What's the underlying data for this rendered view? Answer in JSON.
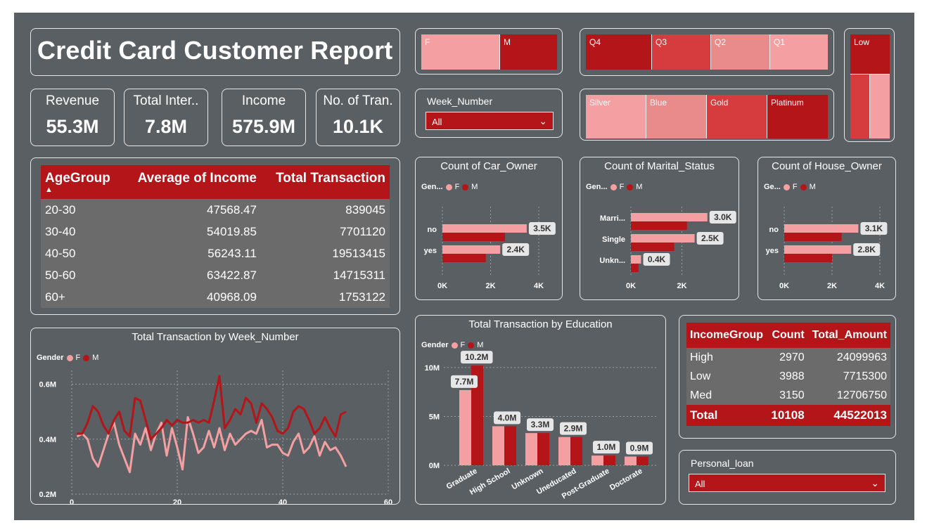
{
  "title": "Credit Card Customer Report",
  "kpis": [
    {
      "label": "Revenue",
      "value": "55.3M"
    },
    {
      "label": "Total Inter..",
      "value": "7.8M"
    },
    {
      "label": "Income",
      "value": "575.9M"
    },
    {
      "label": "No. of Tran.",
      "value": "10.1K"
    }
  ],
  "gender_slicer": [
    "F",
    "M"
  ],
  "quarter_slicer": [
    "Q4",
    "Q3",
    "Q2",
    "Q1"
  ],
  "card_slicer": [
    "Silver",
    "Blue",
    "Gold",
    "Platinum"
  ],
  "risk_slicer": [
    "Low"
  ],
  "week_filter": {
    "label": "Week_Number",
    "value": "All"
  },
  "loan_filter": {
    "label": "Personal_loan",
    "value": "All"
  },
  "age_table": {
    "headers": [
      "AgeGroup",
      "Average of Income",
      "Total Transaction"
    ],
    "rows": [
      [
        "20-30",
        "47568.47",
        "839045"
      ],
      [
        "30-40",
        "54019.85",
        "7701120"
      ],
      [
        "40-50",
        "56243.11",
        "19513415"
      ],
      [
        "50-60",
        "63422.87",
        "14715311"
      ],
      [
        "60+",
        "40968.09",
        "1753122"
      ]
    ]
  },
  "income_table": {
    "headers": [
      "IncomeGroup",
      "Count",
      "Total_Amount"
    ],
    "rows": [
      [
        "High",
        "2970",
        "24099963"
      ],
      [
        "Low",
        "3988",
        "7715300"
      ],
      [
        "Med",
        "3150",
        "12706750"
      ]
    ],
    "total": [
      "Total",
      "10108",
      "44522013"
    ]
  },
  "colors": {
    "female": "#f4a0a2",
    "male": "#b31519",
    "canvas": "#5a5f63"
  },
  "chart_data": [
    {
      "type": "bar",
      "title": "Count of Car_Owner",
      "legend_title": "Gen...",
      "categories": [
        "no",
        "yes"
      ],
      "series": [
        {
          "name": "F",
          "values": [
            3500,
            2400
          ]
        },
        {
          "name": "M",
          "values": [
            2600,
            1800
          ]
        }
      ],
      "data_labels": [
        "3.5K",
        "2.4K"
      ],
      "xticks": [
        "0K",
        "2K",
        "4K"
      ],
      "xlim": [
        0,
        4000
      ]
    },
    {
      "type": "bar",
      "title": "Count of Marital_Status",
      "legend_title": "Gen...",
      "categories": [
        "Marri...",
        "Single",
        "Unkn..."
      ],
      "series": [
        {
          "name": "F",
          "values": [
            3000,
            2500,
            400
          ]
        },
        {
          "name": "M",
          "values": [
            2200,
            1700,
            300
          ]
        }
      ],
      "data_labels": [
        "3.0K",
        "2.5K",
        "0.4K"
      ],
      "xticks": [
        "0K",
        "2K"
      ],
      "xlim": [
        0,
        4000
      ]
    },
    {
      "type": "bar",
      "title": "Count of House_Owner",
      "legend_title": "Ge...",
      "categories": [
        "no",
        "yes"
      ],
      "series": [
        {
          "name": "F",
          "values": [
            3100,
            2800
          ]
        },
        {
          "name": "M",
          "values": [
            2400,
            2000
          ]
        }
      ],
      "data_labels": [
        "3.1K",
        "2.8K"
      ],
      "xticks": [
        "0K",
        "2K",
        "4K"
      ],
      "xlim": [
        0,
        4000
      ]
    },
    {
      "type": "bar",
      "title": "Total Transaction by Education",
      "legend_title": "Gender",
      "categories": [
        "Graduate",
        "High School",
        "Unknown",
        "Uneducated",
        "Post-Graduate",
        "Doctorate"
      ],
      "series": [
        {
          "name": "F",
          "values": [
            7.7,
            4.0,
            3.3,
            2.9,
            1.0,
            0.9
          ]
        },
        {
          "name": "M",
          "values": [
            10.2,
            4.0,
            3.3,
            2.9,
            1.0,
            0.9
          ]
        }
      ],
      "data_labels": [
        "7.7M",
        "10.2M",
        "4.0M",
        "3.3M",
        "2.9M",
        "1.0M",
        "0.9M"
      ],
      "yticks": [
        "0M",
        "5M",
        "10M"
      ],
      "ylim": [
        0,
        11
      ]
    },
    {
      "type": "line",
      "title": "Total Transaction by Week_Number",
      "legend_title": "Gender",
      "x": [
        1,
        2,
        3,
        4,
        5,
        6,
        7,
        8,
        9,
        10,
        11,
        12,
        13,
        14,
        15,
        16,
        17,
        18,
        19,
        20,
        21,
        22,
        23,
        24,
        25,
        26,
        27,
        28,
        29,
        30,
        31,
        32,
        33,
        34,
        35,
        36,
        37,
        38,
        39,
        40,
        41,
        42,
        43,
        44,
        45,
        46,
        47,
        48,
        49,
        50,
        51,
        52
      ],
      "series": [
        {
          "name": "F",
          "values": [
            0.41,
            0.42,
            0.4,
            0.33,
            0.3,
            0.36,
            0.42,
            0.46,
            0.38,
            0.33,
            0.28,
            0.42,
            0.38,
            0.44,
            0.36,
            0.42,
            0.46,
            0.34,
            0.44,
            0.37,
            0.29,
            0.48,
            0.42,
            0.35,
            0.37,
            0.43,
            0.37,
            0.44,
            0.36,
            0.42,
            0.38,
            0.4,
            0.42,
            0.43,
            0.42,
            0.47,
            0.37,
            0.38,
            0.38,
            0.35,
            0.34,
            0.39,
            0.42,
            0.35,
            0.37,
            0.41,
            0.34,
            0.39,
            0.36,
            0.37,
            0.34,
            0.3
          ]
        },
        {
          "name": "M",
          "values": [
            0.42,
            0.42,
            0.46,
            0.52,
            0.5,
            0.45,
            0.42,
            0.47,
            0.5,
            0.43,
            0.41,
            0.55,
            0.54,
            0.47,
            0.4,
            0.42,
            0.44,
            0.47,
            0.45,
            0.47,
            0.46,
            0.46,
            0.47,
            0.46,
            0.47,
            0.46,
            0.54,
            0.63,
            0.44,
            0.47,
            0.51,
            0.49,
            0.55,
            0.53,
            0.46,
            0.53,
            0.51,
            0.48,
            0.43,
            0.42,
            0.44,
            0.5,
            0.52,
            0.51,
            0.47,
            0.42,
            0.44,
            0.48,
            0.44,
            0.41,
            0.49,
            0.5
          ]
        }
      ],
      "xticks": [
        0,
        20,
        40,
        60
      ],
      "yticks": [
        "0.2M",
        "0.4M",
        "0.6M"
      ],
      "xlim": [
        0,
        60
      ],
      "ylim": [
        0.2,
        0.65
      ]
    }
  ]
}
